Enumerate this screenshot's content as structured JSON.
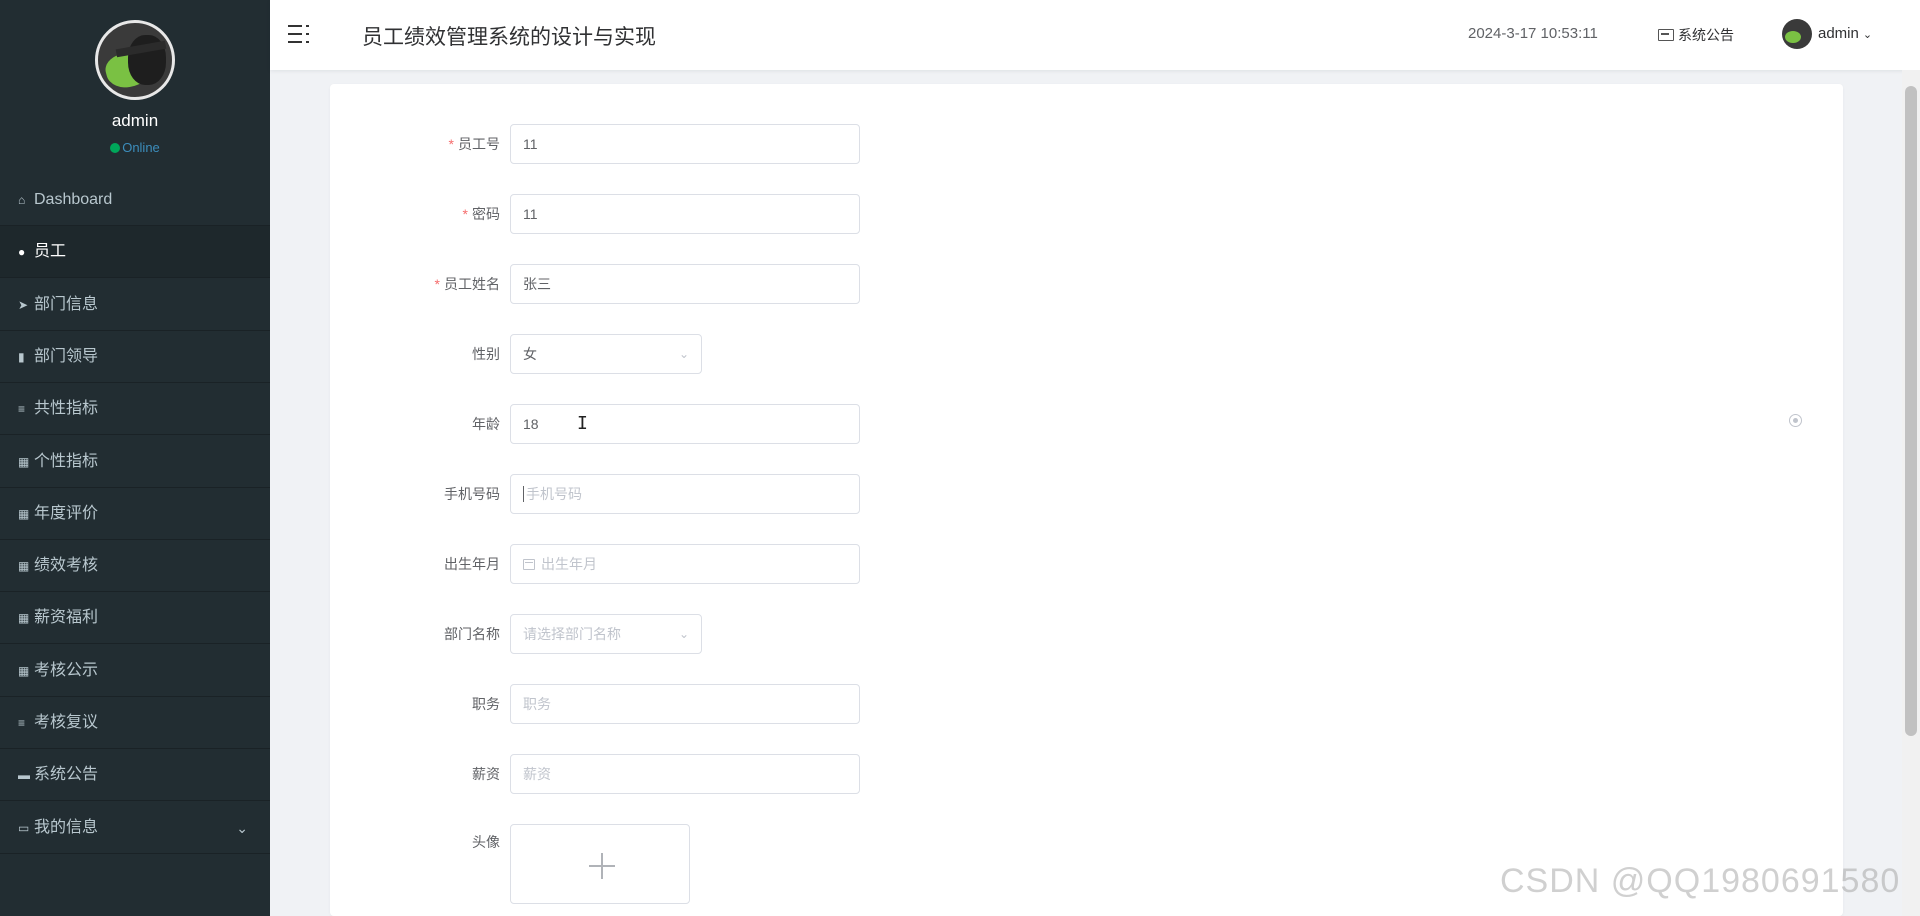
{
  "sidebar": {
    "username": "admin",
    "status": "Online",
    "items": [
      {
        "icon": "home-icon",
        "glyph": "⌂",
        "label": "Dashboard"
      },
      {
        "icon": "location-pin-icon",
        "glyph": "●",
        "label": "员工"
      },
      {
        "icon": "paper-plane-icon",
        "glyph": "➤",
        "label": "部门信息"
      },
      {
        "icon": "user-card-icon",
        "glyph": "▮",
        "label": "部门领导"
      },
      {
        "icon": "list-icon",
        "glyph": "≡",
        "label": "共性指标"
      },
      {
        "icon": "grid-icon",
        "glyph": "▦",
        "label": "个性指标"
      },
      {
        "icon": "grid-icon",
        "glyph": "▦",
        "label": "年度评价"
      },
      {
        "icon": "grid-icon",
        "glyph": "▦",
        "label": "绩效考核"
      },
      {
        "icon": "grid-icon",
        "glyph": "▦",
        "label": "薪资福利"
      },
      {
        "icon": "grid-icon",
        "glyph": "▦",
        "label": "考核公示"
      },
      {
        "icon": "list-icon",
        "glyph": "≡",
        "label": "考核复议"
      },
      {
        "icon": "ticket-icon",
        "glyph": "▬",
        "label": "系统公告"
      },
      {
        "icon": "card-icon",
        "glyph": "▭",
        "label": "我的信息"
      }
    ],
    "active_index": 1
  },
  "header": {
    "title": "员工绩效管理系统的设计与实现",
    "datetime": "2024-3-17 10:53:11",
    "notice_label": "系统公告",
    "user": "admin"
  },
  "form": {
    "employee_no": {
      "label": "员工号",
      "value": "11",
      "required": true
    },
    "password": {
      "label": "密码",
      "value": "11",
      "required": true
    },
    "name": {
      "label": "员工姓名",
      "value": "张三",
      "required": true
    },
    "gender": {
      "label": "性别",
      "value": "女"
    },
    "age": {
      "label": "年龄",
      "value": "18"
    },
    "phone": {
      "label": "手机号码",
      "placeholder": "手机号码"
    },
    "birth": {
      "label": "出生年月",
      "placeholder": "出生年月"
    },
    "department": {
      "label": "部门名称",
      "placeholder": "请选择部门名称"
    },
    "position": {
      "label": "职务",
      "placeholder": "职务"
    },
    "salary": {
      "label": "薪资",
      "placeholder": "薪资"
    },
    "avatar": {
      "label": "头像"
    }
  },
  "watermark": "CSDN @QQ1980691580"
}
